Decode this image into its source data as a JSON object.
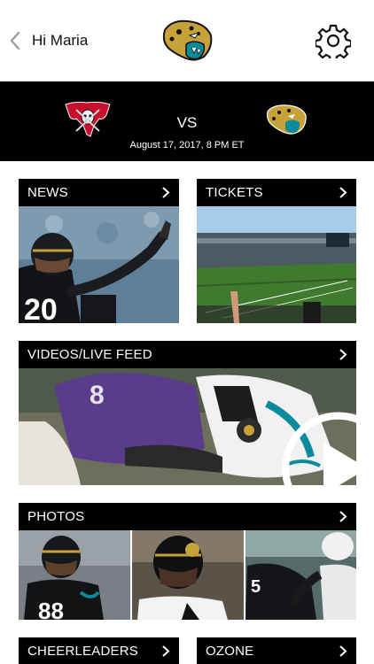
{
  "header": {
    "greeting": "Hi Maria",
    "back_icon": "chevron-left-icon",
    "settings_icon": "gear-icon"
  },
  "matchup": {
    "vs": "VS",
    "date": "August 17, 2017, 8 PM ET"
  },
  "cards": {
    "news": "NEWS",
    "tickets": "TICKETS",
    "videos": "VIDEOS/LIVE FEED",
    "photos": "PHOTOS",
    "cheerleaders": "CHEERLEADERS",
    "ozone": "OZONE"
  },
  "colors": {
    "bar": "#000000",
    "jaguars_teal": "#0a8a9a",
    "jaguars_gold": "#c7a23a",
    "bucs_red": "#c8102e"
  }
}
